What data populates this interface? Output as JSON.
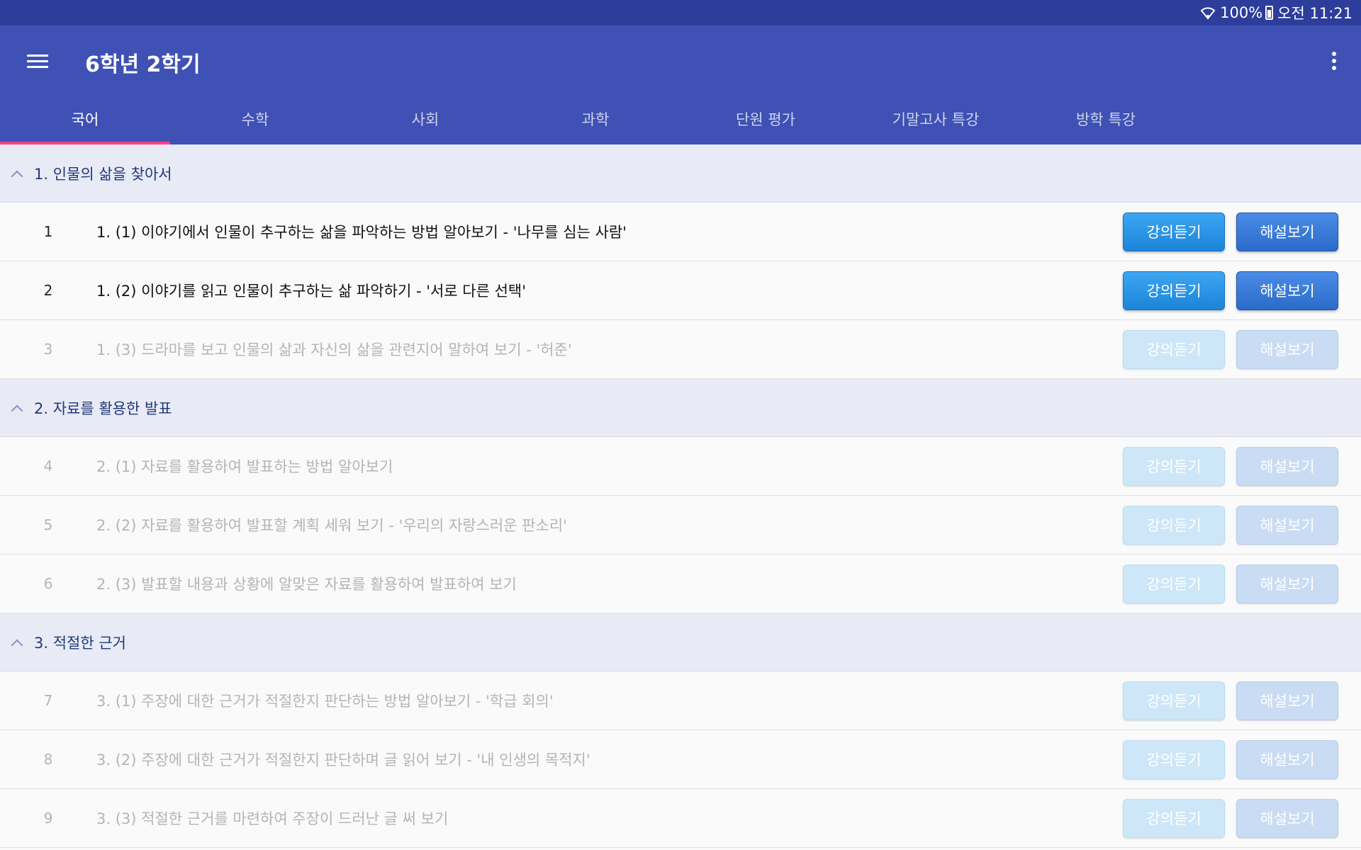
{
  "status_bar": {
    "battery": "100%",
    "time": "오전 11:21"
  },
  "app_bar": {
    "title": "6학년 2학기"
  },
  "tabs": [
    {
      "label": "국어",
      "active": true
    },
    {
      "label": "수학",
      "active": false
    },
    {
      "label": "사회",
      "active": false
    },
    {
      "label": "과학",
      "active": false
    },
    {
      "label": "단원 평가",
      "active": false
    },
    {
      "label": "기말고사 특강",
      "active": false
    },
    {
      "label": "방학 특강",
      "active": false
    }
  ],
  "buttons": {
    "lecture": "강의듣기",
    "explain": "해설보기"
  },
  "sections": [
    {
      "title": "1. 인물의 삶을 찾아서",
      "items": [
        {
          "num": "1",
          "title": "1. (1) 이야기에서 인물이 추구하는 삶을 파악하는 방법 알아보기 - '나무를 심는 사람'",
          "enabled": true
        },
        {
          "num": "2",
          "title": "1. (2) 이야기를 읽고 인물이 추구하는 삶 파악하기 - '서로 다른 선택'",
          "enabled": true
        },
        {
          "num": "3",
          "title": "1. (3) 드라마를 보고 인물의 삶과 자신의 삶을 관련지어 말하여 보기 - '허준'",
          "enabled": false
        }
      ]
    },
    {
      "title": "2. 자료를 활용한 발표",
      "items": [
        {
          "num": "4",
          "title": "2. (1) 자료를 활용하여 발표하는 방법 알아보기",
          "enabled": false
        },
        {
          "num": "5",
          "title": "2. (2) 자료를 활용하여 발표할 계획 세워 보기 - '우리의 자랑스러운 판소리'",
          "enabled": false
        },
        {
          "num": "6",
          "title": "2. (3) 발표할 내용과 상황에 알맞은 자료를 활용하여 발표하여 보기",
          "enabled": false
        }
      ]
    },
    {
      "title": "3. 적절한 근거",
      "items": [
        {
          "num": "7",
          "title": "3. (1) 주장에 대한 근거가 적절한지 판단하는 방법 알아보기 - '학급 회의'",
          "enabled": false
        },
        {
          "num": "8",
          "title": "3. (2) 주장에 대한 근거가 적절한지 판단하며 글 읽어 보기 - '내 인생의 목적지'",
          "enabled": false
        },
        {
          "num": "9",
          "title": "3. (3) 적절한 근거를 마련하여 주장이 드러난 글 써 보기",
          "enabled": false
        }
      ]
    }
  ],
  "icons": [
    "wifi-icon",
    "battery-icon",
    "menu-icon",
    "more-vert-icon",
    "chevron-up-icon"
  ],
  "colors": {
    "app_bar": "#3f51b5",
    "status_bar": "#2d3d9b",
    "tab_indicator": "#ff4081",
    "section_bg": "#e8eaf6"
  }
}
